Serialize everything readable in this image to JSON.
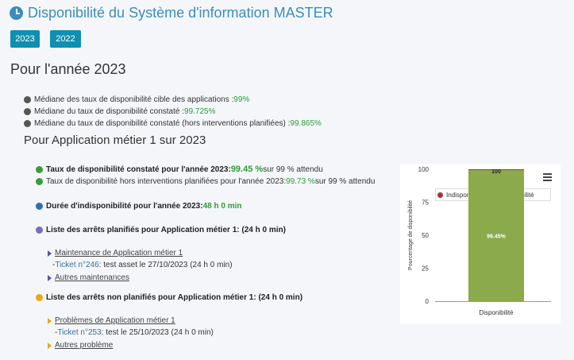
{
  "header": {
    "title": "Disponibilité du Système d'information MASTER"
  },
  "years": [
    "2023",
    "2022"
  ],
  "section_year": "Pour l'année 2023",
  "medians": [
    {
      "label": "Médiane des taux de disponibilité cible des applications : ",
      "value": "99%"
    },
    {
      "label": "Médiane du taux de disponibilité constaté : ",
      "value": "99.725%"
    },
    {
      "label": "Médiane du taux de disponibilité constaté (hors interventions planifiées) : ",
      "value": "99.865%"
    }
  ],
  "section_app": "Pour Application métier 1 sur 2023",
  "stats": {
    "observed_label": "Taux de disponibilité constaté pour l'année 2023: ",
    "observed_value": "99.45 %",
    "observed_suffix": " sur 99 % attendu",
    "excl_label": "Taux de disponibilité hors interventions planifiées pour l'année 2023: ",
    "excl_value": "99.73 %",
    "excl_suffix": " sur 99 % attendu",
    "downtime_label": "Durée d'indisponibilité pour l'année 2023: ",
    "downtime_value": "48 h 0 min"
  },
  "planned": {
    "heading": "Liste des arrêts planifiés pour Application métier 1: (24 h 0 min)",
    "group": "Maintenance de Application métier 1",
    "ticket_prefix": "- ",
    "ticket": "Ticket n°246",
    "ticket_desc": ": test asset le 27/10/2023 (24 h 0 min)",
    "more": "Autres maintenances"
  },
  "unplanned": {
    "heading": "Liste des arrêts non planifiés pour Application métier 1: (24 h 0 min)",
    "group": "Problèmes de Application métier 1",
    "ticket_prefix": "- ",
    "ticket": "Ticket n°253",
    "ticket_desc": ": test le 25/10/2023 (24 h 0 min)",
    "more": "Autres problème"
  },
  "colors": {
    "accent": "#3c8dbc",
    "button": "#0f8fb2",
    "value_green": "#2e9c3a",
    "bullet_grey": "#555555",
    "bullet_green": "#3a9b3c",
    "bullet_blue": "#2b6fba",
    "bullet_purple": "#7c6bb8",
    "bullet_orange": "#e5a91b",
    "bar_green": "#8aaa4b",
    "bar_red": "#b03030"
  },
  "chart_data": {
    "type": "bar",
    "stacked": true,
    "categories": [
      "Disponibilité"
    ],
    "series": [
      {
        "name": "Indisponibilité",
        "values": [
          0.55
        ],
        "color": "#b03030"
      },
      {
        "name": "Disponibilité",
        "values": [
          99.45
        ],
        "color": "#8aaa4b"
      }
    ],
    "data_labels": [
      "100",
      "99.45%"
    ],
    "ylabel": "Pourcentage de disponibilité",
    "ylim": [
      0,
      100
    ],
    "yticks": [
      "0",
      "25",
      "50",
      "75",
      "100"
    ],
    "legend_position": "top-right"
  }
}
